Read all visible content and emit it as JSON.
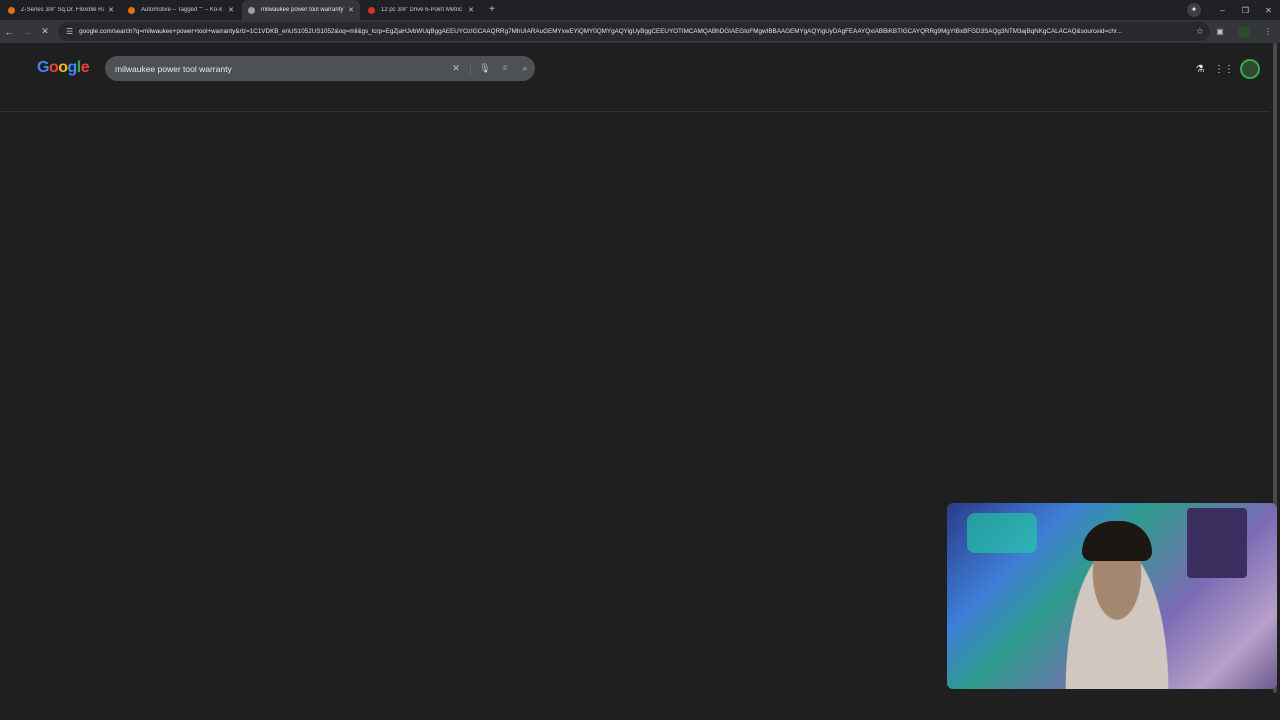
{
  "tabs": [
    {
      "title": "Z-Series 3/8\" Sq.Dr. Flexible Ra",
      "color": "#e8710a",
      "active": false
    },
    {
      "title": "Automotive – Tagged \"\" – Ko-k",
      "color": "#e8710a",
      "active": false
    },
    {
      "title": "milwaukee power tool warranty",
      "color": "#9aa0a6",
      "active": true
    },
    {
      "title": "12 pc 3/8\" Drive 6-Point Metric",
      "color": "#d93025",
      "active": false
    }
  ],
  "new_tab": "+",
  "window": {
    "close": "✕",
    "minimize": "–",
    "restore": "❐",
    "gemini": "✦"
  },
  "toolbar": {
    "url": "google.com/search?q=milwaukee+power+tool+warranty&rlz=1C1VDKB_enUS1052US1052&oq=mil&gs_lcrp=EgZjaHJvbWUqBggAEEUYOzIGCAAQRRg7MhUIARAuGEMYxwEYiQMY0QMYgAQYigUyBggCEEUYOTIMCAMQABhDGIAEGIoFMgwIBBAAGEMYgAQYigUyDAgFEAAYQxiABBiKBTIGCAYQRRg9MgYIBxBFGD3SAQg3NTM3ajBqNKgCALACAQ&sourceid=chr..."
  },
  "search": {
    "logo": [
      "G",
      "o",
      "o",
      "g",
      "l",
      "e"
    ],
    "query": "milwaukee power tool warranty"
  },
  "colors": {
    "google_blue": "#4285f4",
    "google_red": "#ea4335",
    "google_yellow": "#fbbc05",
    "google_green": "#34a853"
  }
}
